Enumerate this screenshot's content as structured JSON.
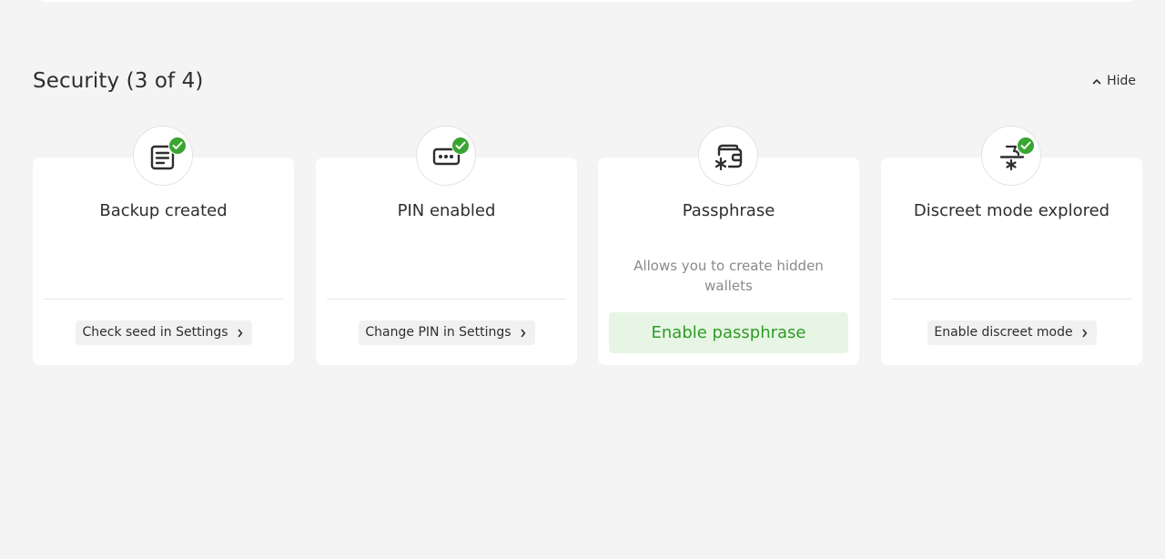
{
  "section": {
    "title": "Security (3 of 4)",
    "hide_label": "Hide"
  },
  "cards": [
    {
      "icon": "backup-icon",
      "completed": true,
      "title": "Backup created",
      "description": "",
      "action_label": "Check seed in Settings"
    },
    {
      "icon": "pin-icon",
      "completed": true,
      "title": "PIN enabled",
      "description": "",
      "action_label": "Change PIN in Settings"
    },
    {
      "icon": "passphrase-wallet-icon",
      "completed": false,
      "title": "Passphrase",
      "description": "Allows you to create hidden wallets",
      "action_label": "Enable passphrase"
    },
    {
      "icon": "discreet-mode-icon",
      "completed": true,
      "title": "Discreet mode explored",
      "description": "",
      "action_label": "Enable discreet mode"
    }
  ],
  "colors": {
    "background": "#f4f4f4",
    "card": "#ffffff",
    "accent_green": "#3aa531",
    "primary_button_bg": "#e7f6e4",
    "primary_button_text": "#2f9a27"
  }
}
